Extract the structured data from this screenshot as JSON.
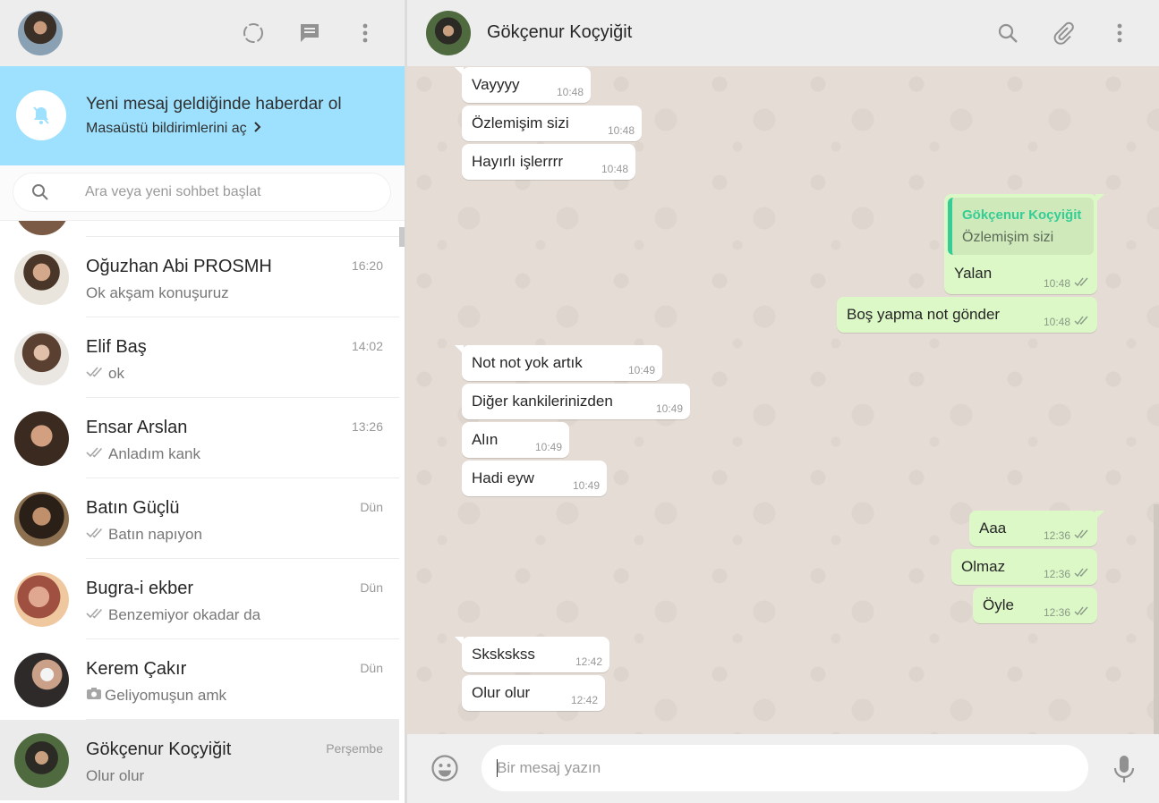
{
  "left_header": {
    "status_icon": "status-icon",
    "new_chat_icon": "new-chat-icon",
    "menu_icon": "menu-icon"
  },
  "notification": {
    "icon": "bell-off-icon",
    "title": "Yeni mesaj geldiğinde haberdar ol",
    "link": "Masaüstü bildirimlerini aç",
    "link_icon": "chevron-right-icon"
  },
  "search": {
    "placeholder": "Ara veya yeni sohbet başlat",
    "value": ""
  },
  "chats": [
    {
      "name": "Oğuzhan Abi PROSMH",
      "time": "16:20",
      "preview": "Ok akşam konuşuruz",
      "ticks": false,
      "photo": false
    },
    {
      "name": "Elif Baş",
      "time": "14:02",
      "preview": "ok",
      "ticks": true,
      "photo": false
    },
    {
      "name": "Ensar Arslan",
      "time": "13:26",
      "preview": "Anladım kank",
      "ticks": true,
      "photo": false
    },
    {
      "name": "Batın Güçlü",
      "time": "Dün",
      "preview": "Batın napıyon",
      "ticks": true,
      "photo": false
    },
    {
      "name": "Bugra-i ekber",
      "time": "Dün",
      "preview": "Benzemiyor okadar da",
      "ticks": true,
      "photo": false
    },
    {
      "name": "Kerem Çakır",
      "time": "Dün",
      "preview": "Geliyomuşun amk",
      "ticks": false,
      "photo": true
    },
    {
      "name": "Gökçenur Koçyiğit",
      "time": "Perşembe",
      "preview": "Olur olur",
      "ticks": false,
      "photo": false,
      "active": true
    }
  ],
  "conversation": {
    "contact_name": "Gökçenur Koçyiğit",
    "header_icons": [
      "search-icon",
      "attach-icon",
      "menu-icon"
    ],
    "messages": [
      {
        "dir": "in",
        "text": "Vayyyy",
        "time": "10:48"
      },
      {
        "dir": "in",
        "text": "Özlemişim sizi",
        "time": "10:48"
      },
      {
        "dir": "in",
        "text": "Hayırlı işlerrrr",
        "time": "10:48"
      },
      {
        "dir": "out",
        "text": "Yalan",
        "time": "10:48",
        "quote_author": "Gökçenur Koçyiğit",
        "quote_text": "Özlemişim sizi"
      },
      {
        "dir": "out",
        "text": "Boş yapma not gönder",
        "time": "10:48"
      },
      {
        "dir": "in",
        "text": "Not not yok artık",
        "time": "10:49"
      },
      {
        "dir": "in",
        "text": "Diğer kankilerinizden",
        "time": "10:49"
      },
      {
        "dir": "in",
        "text": "Alın",
        "time": "10:49"
      },
      {
        "dir": "in",
        "text": "Hadi eyw",
        "time": "10:49"
      },
      {
        "dir": "out",
        "text": "Aaa",
        "time": "12:36"
      },
      {
        "dir": "out",
        "text": "Olmaz",
        "time": "12:36"
      },
      {
        "dir": "out",
        "text": "Öyle",
        "time": "12:36"
      },
      {
        "dir": "in",
        "text": "Skskskss",
        "time": "12:42"
      },
      {
        "dir": "in",
        "text": "Olur olur",
        "time": "12:42"
      }
    ]
  },
  "composer": {
    "placeholder": "Bir mesaj yazın",
    "value": "",
    "emoji_icon": "emoji-icon",
    "mic_icon": "microphone-icon"
  },
  "colors": {
    "notification_bg": "#9de1fe",
    "outgoing_bubble": "#dcf8c6",
    "incoming_bubble": "#ffffff",
    "quote_accent": "#35cd96",
    "chat_bg": "#e5ddd5"
  }
}
